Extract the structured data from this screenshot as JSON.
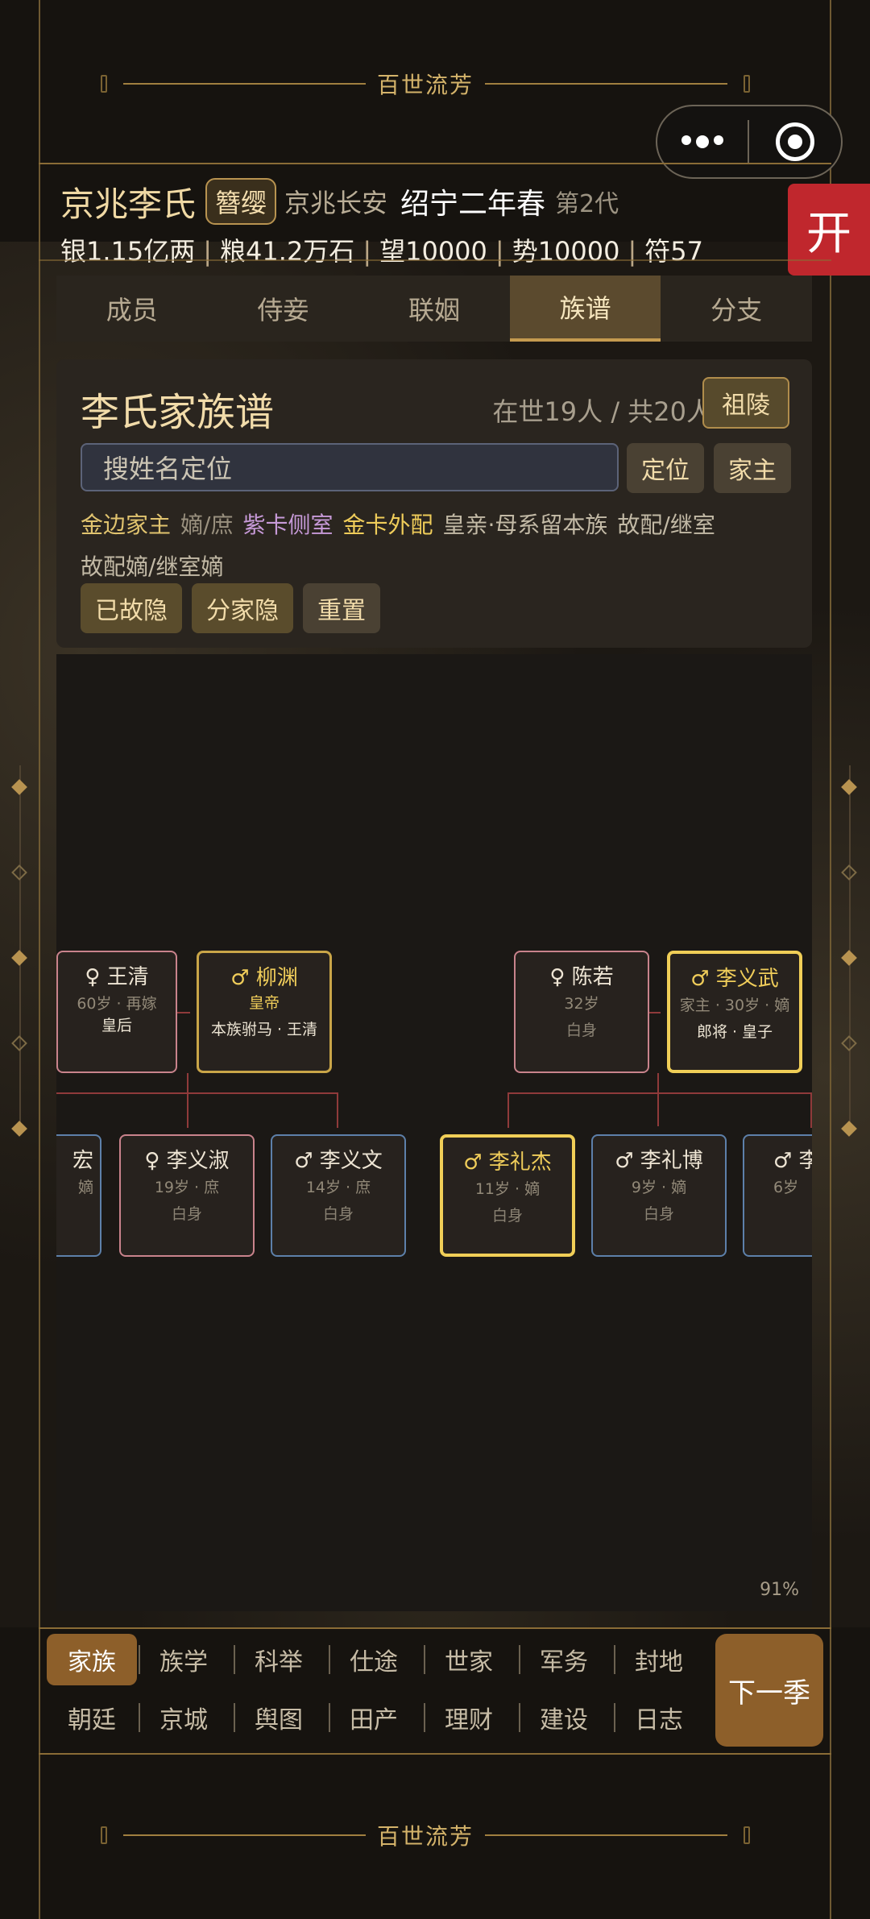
{
  "banner_text": "百世流芳",
  "header": {
    "clan": "京兆李氏",
    "badge": "簪缨",
    "location": "京兆长安",
    "era": "绍宁二年春",
    "generation": "第2代",
    "stats": [
      "银1.15亿两",
      "粮41.2万石",
      "望10000",
      "势10000",
      "符57"
    ]
  },
  "side_button": "开",
  "tabs": [
    {
      "label": "成员",
      "active": false
    },
    {
      "label": "侍妾",
      "active": false
    },
    {
      "label": "联姻",
      "active": false
    },
    {
      "label": "族谱",
      "active": true
    },
    {
      "label": "分支",
      "active": false
    }
  ],
  "panel": {
    "title": "李氏家族谱",
    "count": "在世19人 / 共20人",
    "tomb_button": "祖陵",
    "search_placeholder": "搜姓名定位",
    "locate_button": "定位",
    "head_button": "家主",
    "legend": {
      "gold_border_head": "金边家主",
      "legit_concubine": "嫡/庶",
      "purple_side": "紫卡侧室",
      "gold_external": "金卡外配",
      "royal": "皇亲·母系留本族",
      "deceased_spouse": "故配/继室",
      "deceased_legit": "故配嫡/继室嫡"
    },
    "filters": [
      "已故隐",
      "分家隐",
      "重置"
    ]
  },
  "tree": {
    "zoom": "91%",
    "cards": [
      {
        "name": "♀ 王清",
        "meta": "60岁 · 再嫁",
        "status": "皇后"
      },
      {
        "name": "♂ 柳渊",
        "meta": "皇帝",
        "status": "本族驸马 · 王清"
      },
      {
        "name": "♀ 陈若",
        "meta": "32岁",
        "status": "白身"
      },
      {
        "name": "♂ 李义武",
        "meta": "家主 · 30岁 · 嫡",
        "status": "郎将 · 皇子"
      },
      {
        "name": "宏",
        "meta": "嫡",
        "status": ""
      },
      {
        "name": "♀ 李义淑",
        "meta": "19岁 · 庶",
        "status": "白身"
      },
      {
        "name": "♂ 李义文",
        "meta": "14岁 · 庶",
        "status": "白身"
      },
      {
        "name": "♂ 李礼杰",
        "meta": "11岁 · 嫡",
        "status": "白身"
      },
      {
        "name": "♂ 李礼博",
        "meta": "9岁 · 嫡",
        "status": "白身"
      },
      {
        "name": "♂ 李",
        "meta": "6岁",
        "status": "白"
      }
    ]
  },
  "nav": {
    "row1": [
      "家族",
      "族学",
      "科举",
      "仕途",
      "世家",
      "军务",
      "封地"
    ],
    "row2": [
      "朝廷",
      "京城",
      "舆图",
      "田产",
      "理财",
      "建设",
      "日志"
    ],
    "active": "家族",
    "next_button": "下一季"
  }
}
